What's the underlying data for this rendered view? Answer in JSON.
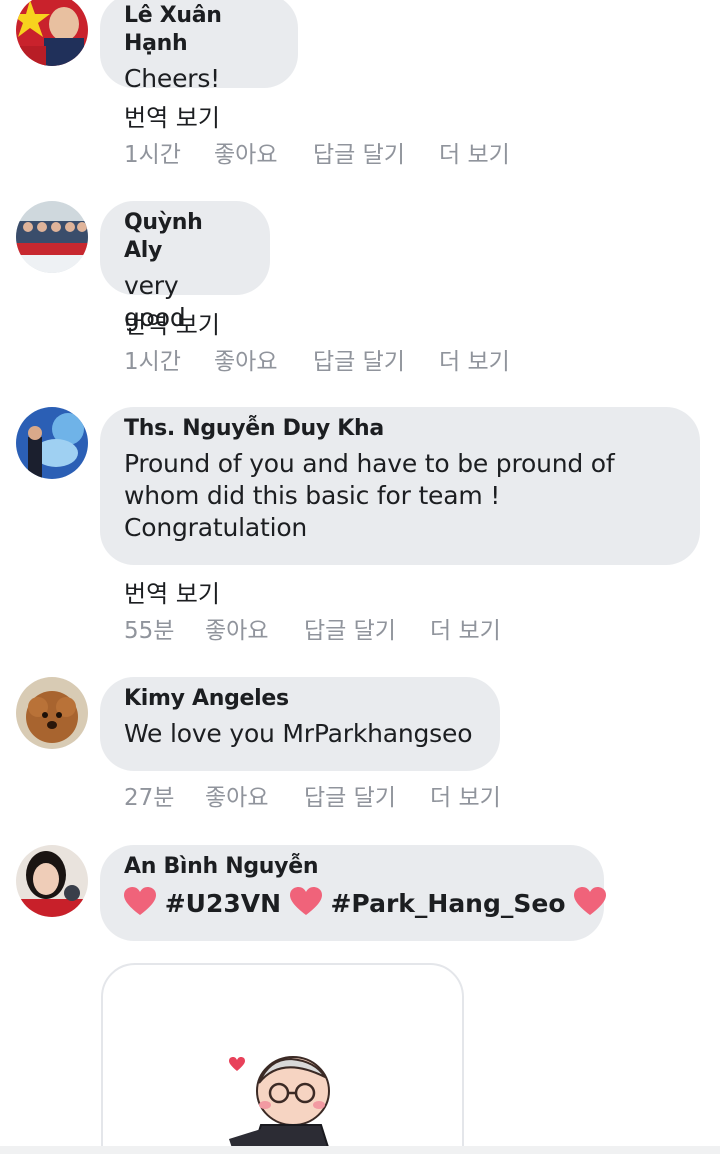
{
  "comments": [
    {
      "author": "Lê Xuân Hạnh",
      "text": "Cheers!",
      "translate": "번역 보기",
      "time": "1시간",
      "like": "좋아요",
      "reply": "답글 달기",
      "more": "더 보기"
    },
    {
      "author": "Quỳnh Aly",
      "text": "very good",
      "translate": "번역 보기",
      "time": "1시간",
      "like": "좋아요",
      "reply": "답글 달기",
      "more": "더 보기"
    },
    {
      "author": "Ths. Nguyễn Duy Kha",
      "text_lines": [
        "Pround of you and have to be pround of",
        "whom did this basic for team !",
        "Congratulation"
      ],
      "translate": "번역 보기",
      "time": "55분",
      "like": "좋아요",
      "reply": "답글 달기",
      "more": "더 보기"
    },
    {
      "author": "Kimy Angeles",
      "text": "We love you MrParkhangseo",
      "time": "27분",
      "like": "좋아요",
      "reply": "답글 달기",
      "more": "더 보기"
    },
    {
      "author": "An Bình Nguyễn",
      "tags": [
        "#U23VN",
        "#Park_Hang_Seo"
      ],
      "heart_color": "#f0637a"
    }
  ],
  "colors": {
    "bubble": "#e9ebee",
    "meta_text": "#90949c",
    "name_text": "#1c1e21"
  },
  "icons": [
    "heart-emoji",
    "sticker-cartoon"
  ]
}
